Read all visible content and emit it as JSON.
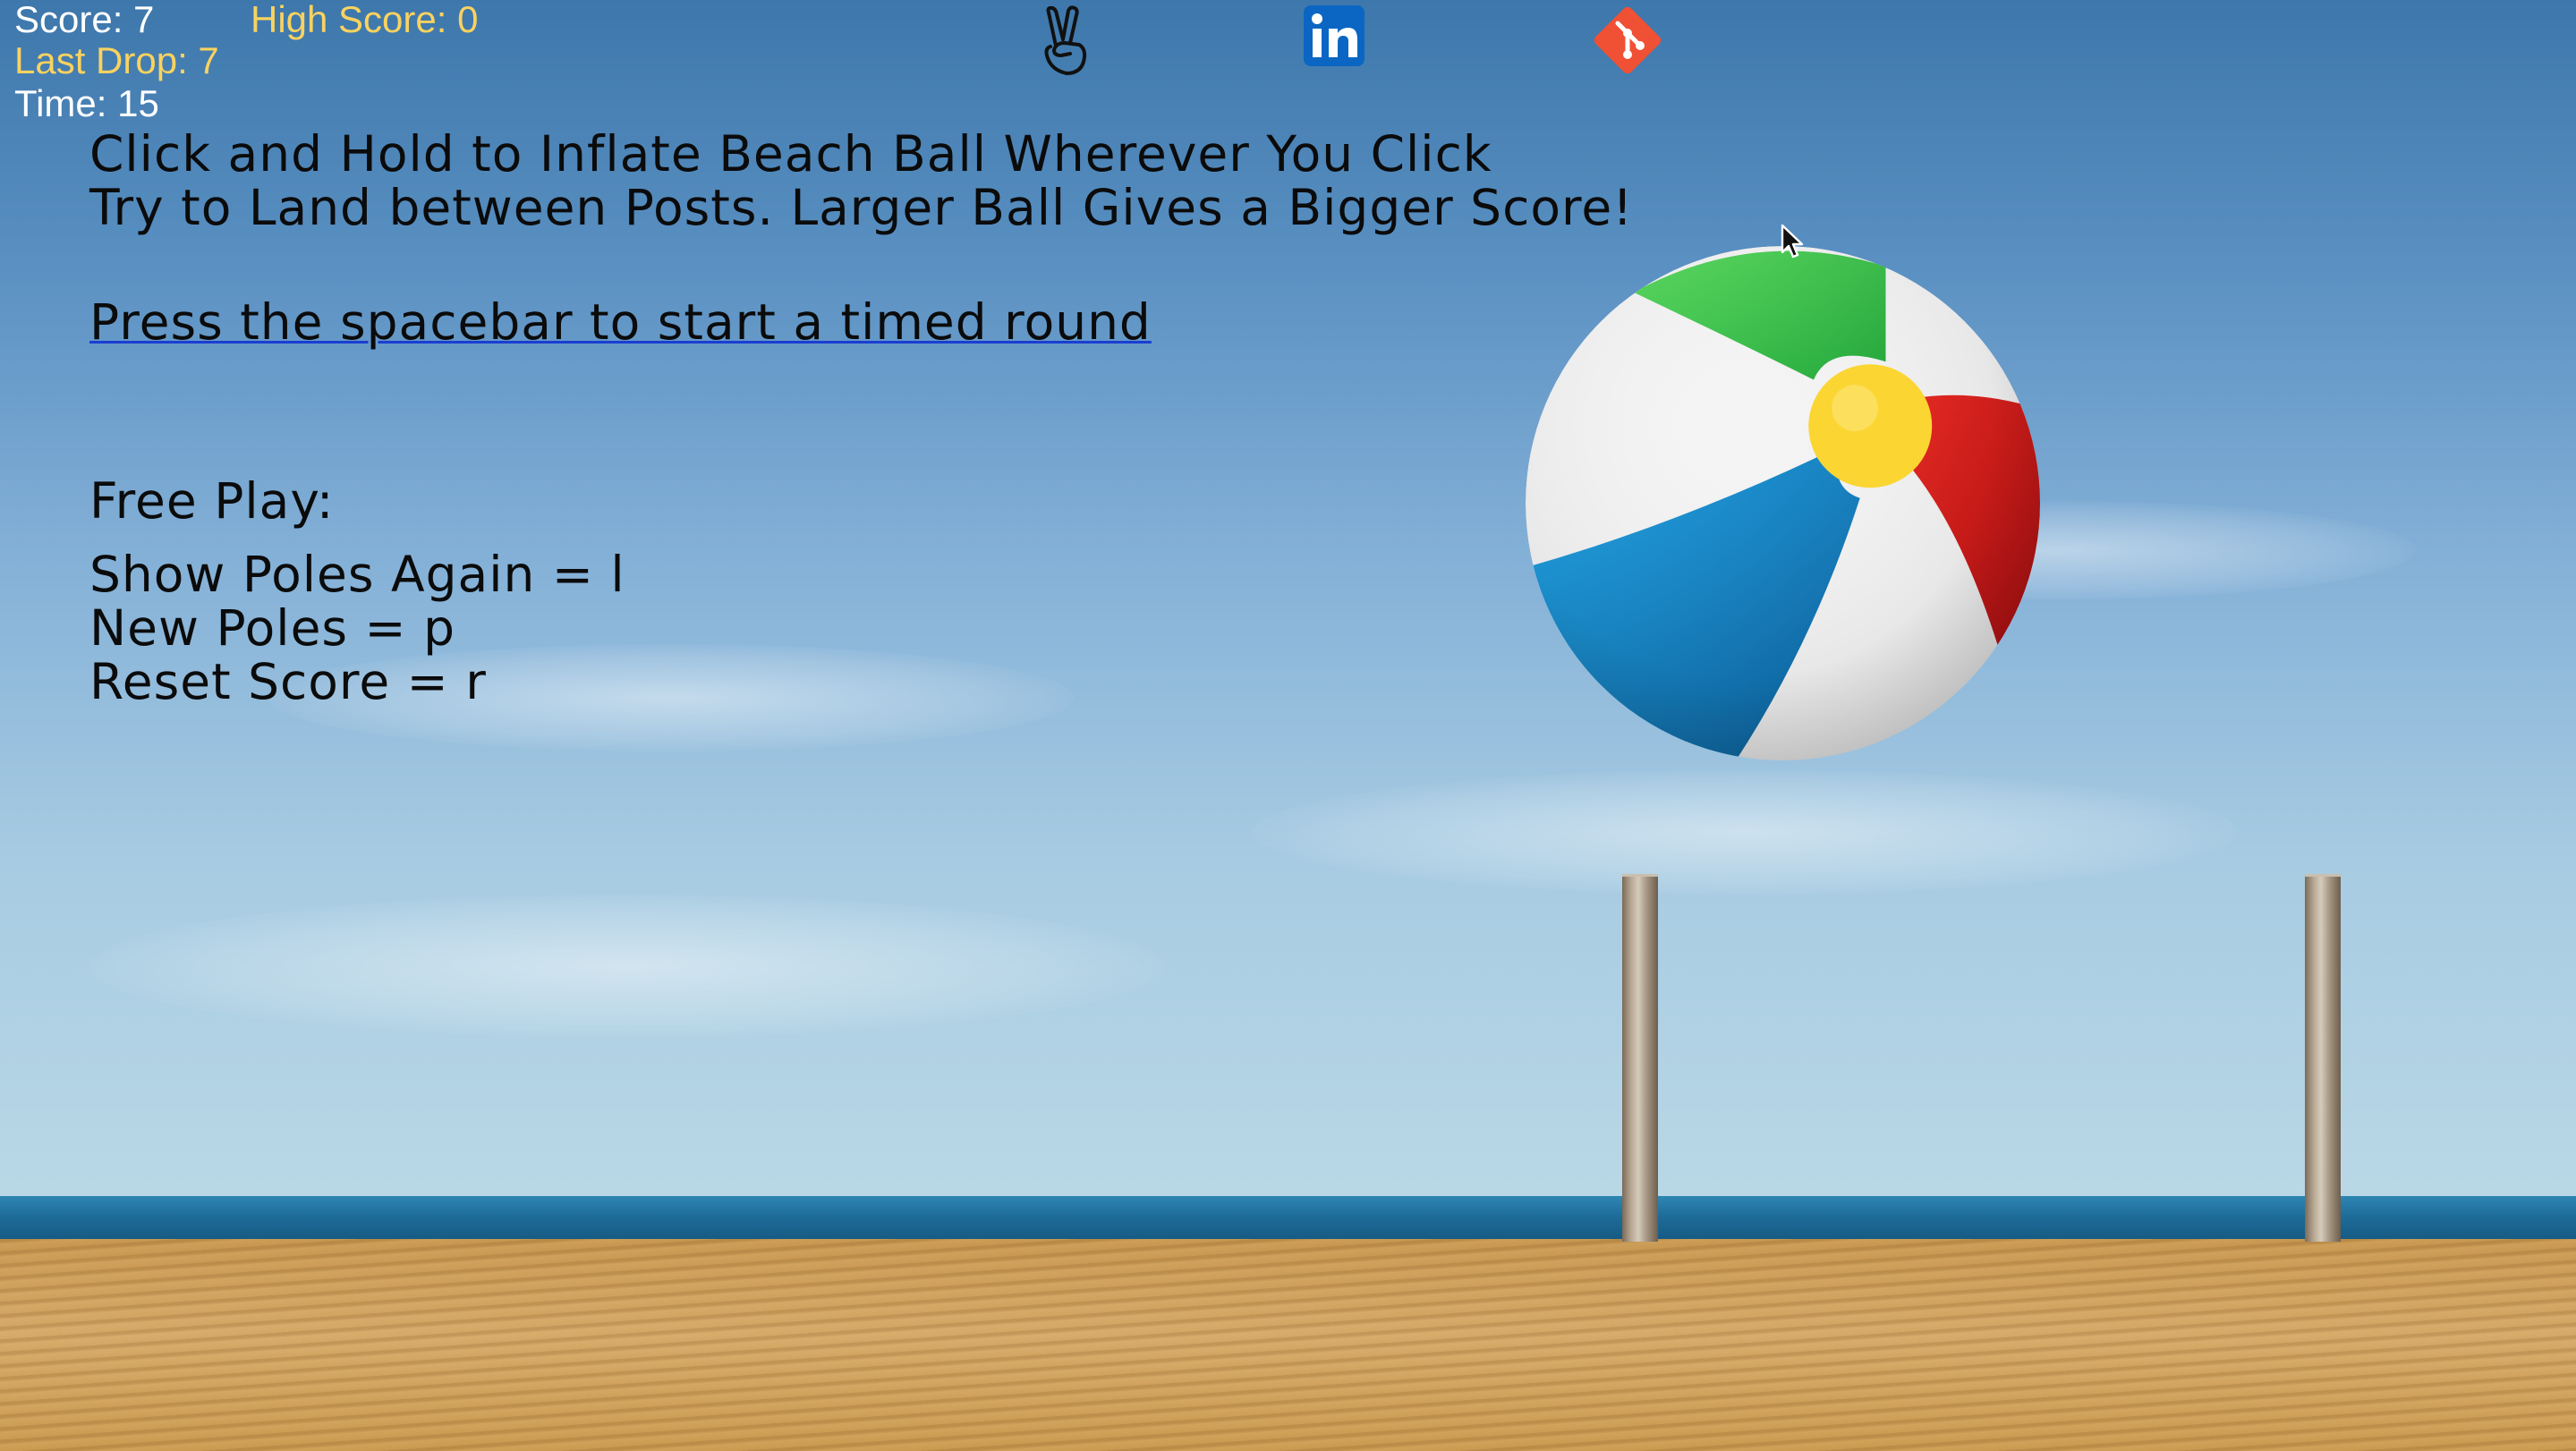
{
  "hud": {
    "score": "Score: 7",
    "high_score": "High Score: 0",
    "last_drop": "Last Drop: 7",
    "time": "Time: 15"
  },
  "instructions": {
    "line1": "Click and Hold to Inflate Beach Ball Wherever You Click",
    "line2": "Try to Land between Posts. Larger Ball Gives a Bigger Score!",
    "start": "Press the spacebar to start a timed round",
    "free_play": "Free Play:",
    "show_poles": "Show Poles Again = l",
    "new_poles": "New Poles = p",
    "reset_score": "Reset Score = r"
  },
  "icons": [
    "peace-hand-icon",
    "linkedin-icon",
    "git-icon"
  ],
  "colors": {
    "hud_yellow": "#f9d25f",
    "hud_white": "#ffffff",
    "link_underline": "#1a3ed1",
    "linkedin_blue": "#0a66c2",
    "git_orange": "#f05033"
  }
}
